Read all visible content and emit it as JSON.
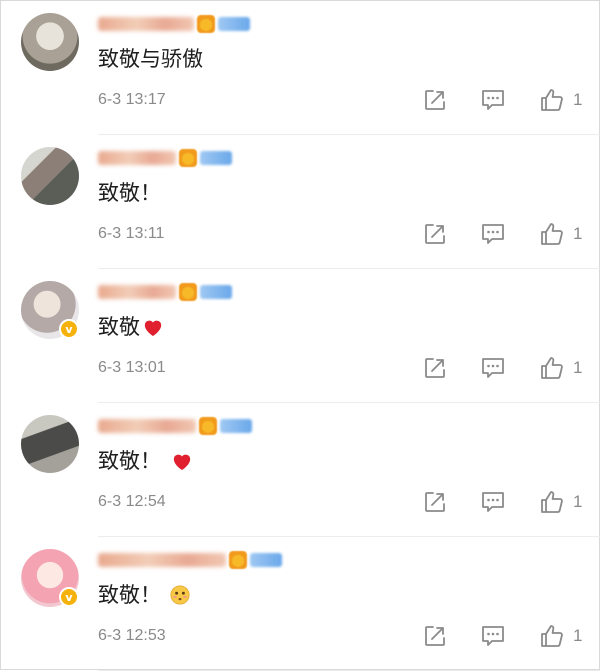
{
  "comments": [
    {
      "text": "致敬与骄傲",
      "emoji": "",
      "time": "6-3 13:17",
      "likes": "1",
      "verified": false,
      "avatar_color": "#b9b2a5",
      "name_blur_width": 96
    },
    {
      "text": "致敬！",
      "emoji": "",
      "time": "6-3 13:11",
      "likes": "1",
      "verified": false,
      "avatar_color": "#8e8f86",
      "name_blur_width": 78
    },
    {
      "text": "致敬",
      "emoji": "heart-icon",
      "time": "6-3 13:01",
      "likes": "1",
      "verified": true,
      "avatar_color": "#c9c4c1",
      "name_blur_width": 78
    },
    {
      "text": "致敬！",
      "emoji": "heart-icon",
      "time": "6-3 12:54",
      "likes": "1",
      "verified": false,
      "avatar_color": "#7f8378",
      "name_blur_width": 98
    },
    {
      "text": "致敬！",
      "emoji": "flushed-face-icon",
      "time": "6-3 12:53",
      "likes": "1",
      "verified": true,
      "avatar_color": "#f1b6c2",
      "name_blur_width": 128
    }
  ],
  "colors": {
    "heart": "#e0202e",
    "verified_badge": "#f6b20c",
    "icon_gray": "#8a8a8a",
    "time_gray": "#8a8a8a"
  },
  "icons": {
    "repost": "repost-icon",
    "comment": "comment-icon",
    "like": "like-icon"
  }
}
